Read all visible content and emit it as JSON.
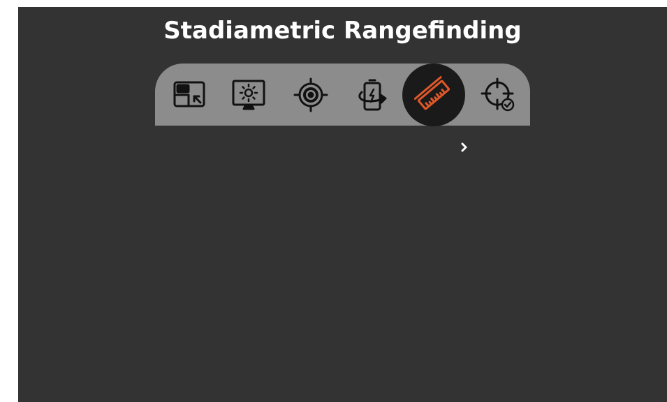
{
  "screen": {
    "title": "Stadiametric Rangefinding"
  },
  "menu": {
    "items": [
      {
        "icon": "picture-in-picture-icon",
        "active": false
      },
      {
        "icon": "display-brightness-icon",
        "active": false
      },
      {
        "icon": "target-focus-icon",
        "active": false
      },
      {
        "icon": "battery-rotate-icon",
        "active": false
      },
      {
        "icon": "ruler-icon",
        "active": true
      },
      {
        "icon": "crosshair-check-icon",
        "active": false
      }
    ],
    "active_color": "#e0582a",
    "icon_color": "#111111"
  },
  "navigation": {
    "next_icon": "chevron-right-icon"
  }
}
